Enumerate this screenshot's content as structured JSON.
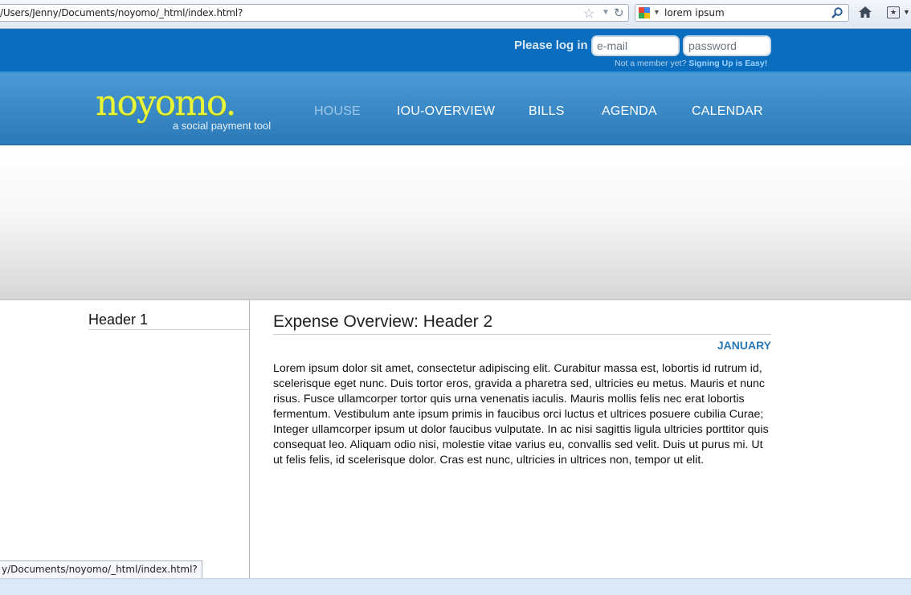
{
  "browser": {
    "url": "/Users/Jenny/Documents/noyomo/_html/index.html?",
    "search_query": "lorem ipsum"
  },
  "login": {
    "label": "Please log in",
    "email_placeholder": "e-mail",
    "password_placeholder": "password",
    "not_member": "Not a member yet?",
    "signup_link": "Signing Up is Easy!"
  },
  "header": {
    "logo_text": "noyomo.",
    "tagline": "a social payment tool",
    "nav": [
      {
        "label": "HOUSE",
        "active": true
      },
      {
        "label": "IOU-OVERVIEW"
      },
      {
        "label": "BILLS"
      },
      {
        "label": "AGENDA"
      },
      {
        "label": "CALENDAR"
      }
    ]
  },
  "sidebar": {
    "title": "Header 1"
  },
  "main": {
    "title": "Expense Overview: Header 2",
    "month": "JANUARY",
    "body": "Lorem ipsum dolor sit amet, consectetur adipiscing elit. Curabitur massa est, lobortis id rutrum id, scelerisque eget nunc. Duis tortor eros, gravida a pharetra sed, ultricies eu metus. Mauris et nunc risus. Fusce ullamcorper tortor quis urna venenatis iaculis. Mauris mollis felis nec erat lobortis fermentum. Vestibulum ante ipsum primis in faucibus orci luctus et ultrices posuere cubilia Curae; Integer ullamcorper ipsum ut dolor faucibus vulputate. In ac nisi sagittis ligula ultricies porttitor quis consequat leo. Aliquam odio nisi, molestie vitae varius eu, convallis sed velit. Duis ut purus mi. Ut ut felis felis, id scelerisque dolor. Cras est nunc, ultricies in ultrices non, tempor ut elit."
  },
  "status": {
    "link_preview": "y/Documents/noyomo/_html/index.html?"
  },
  "colors": {
    "brand_blue": "#0a6dbe",
    "nav_blue": "#3a8ac8",
    "logo_yellow": "#e9f53a",
    "accent_month": "#2a77b4"
  },
  "icons": [
    "star-icon",
    "reload-icon",
    "google-icon",
    "magnifier-icon",
    "home-icon",
    "bookmark-icon"
  ]
}
